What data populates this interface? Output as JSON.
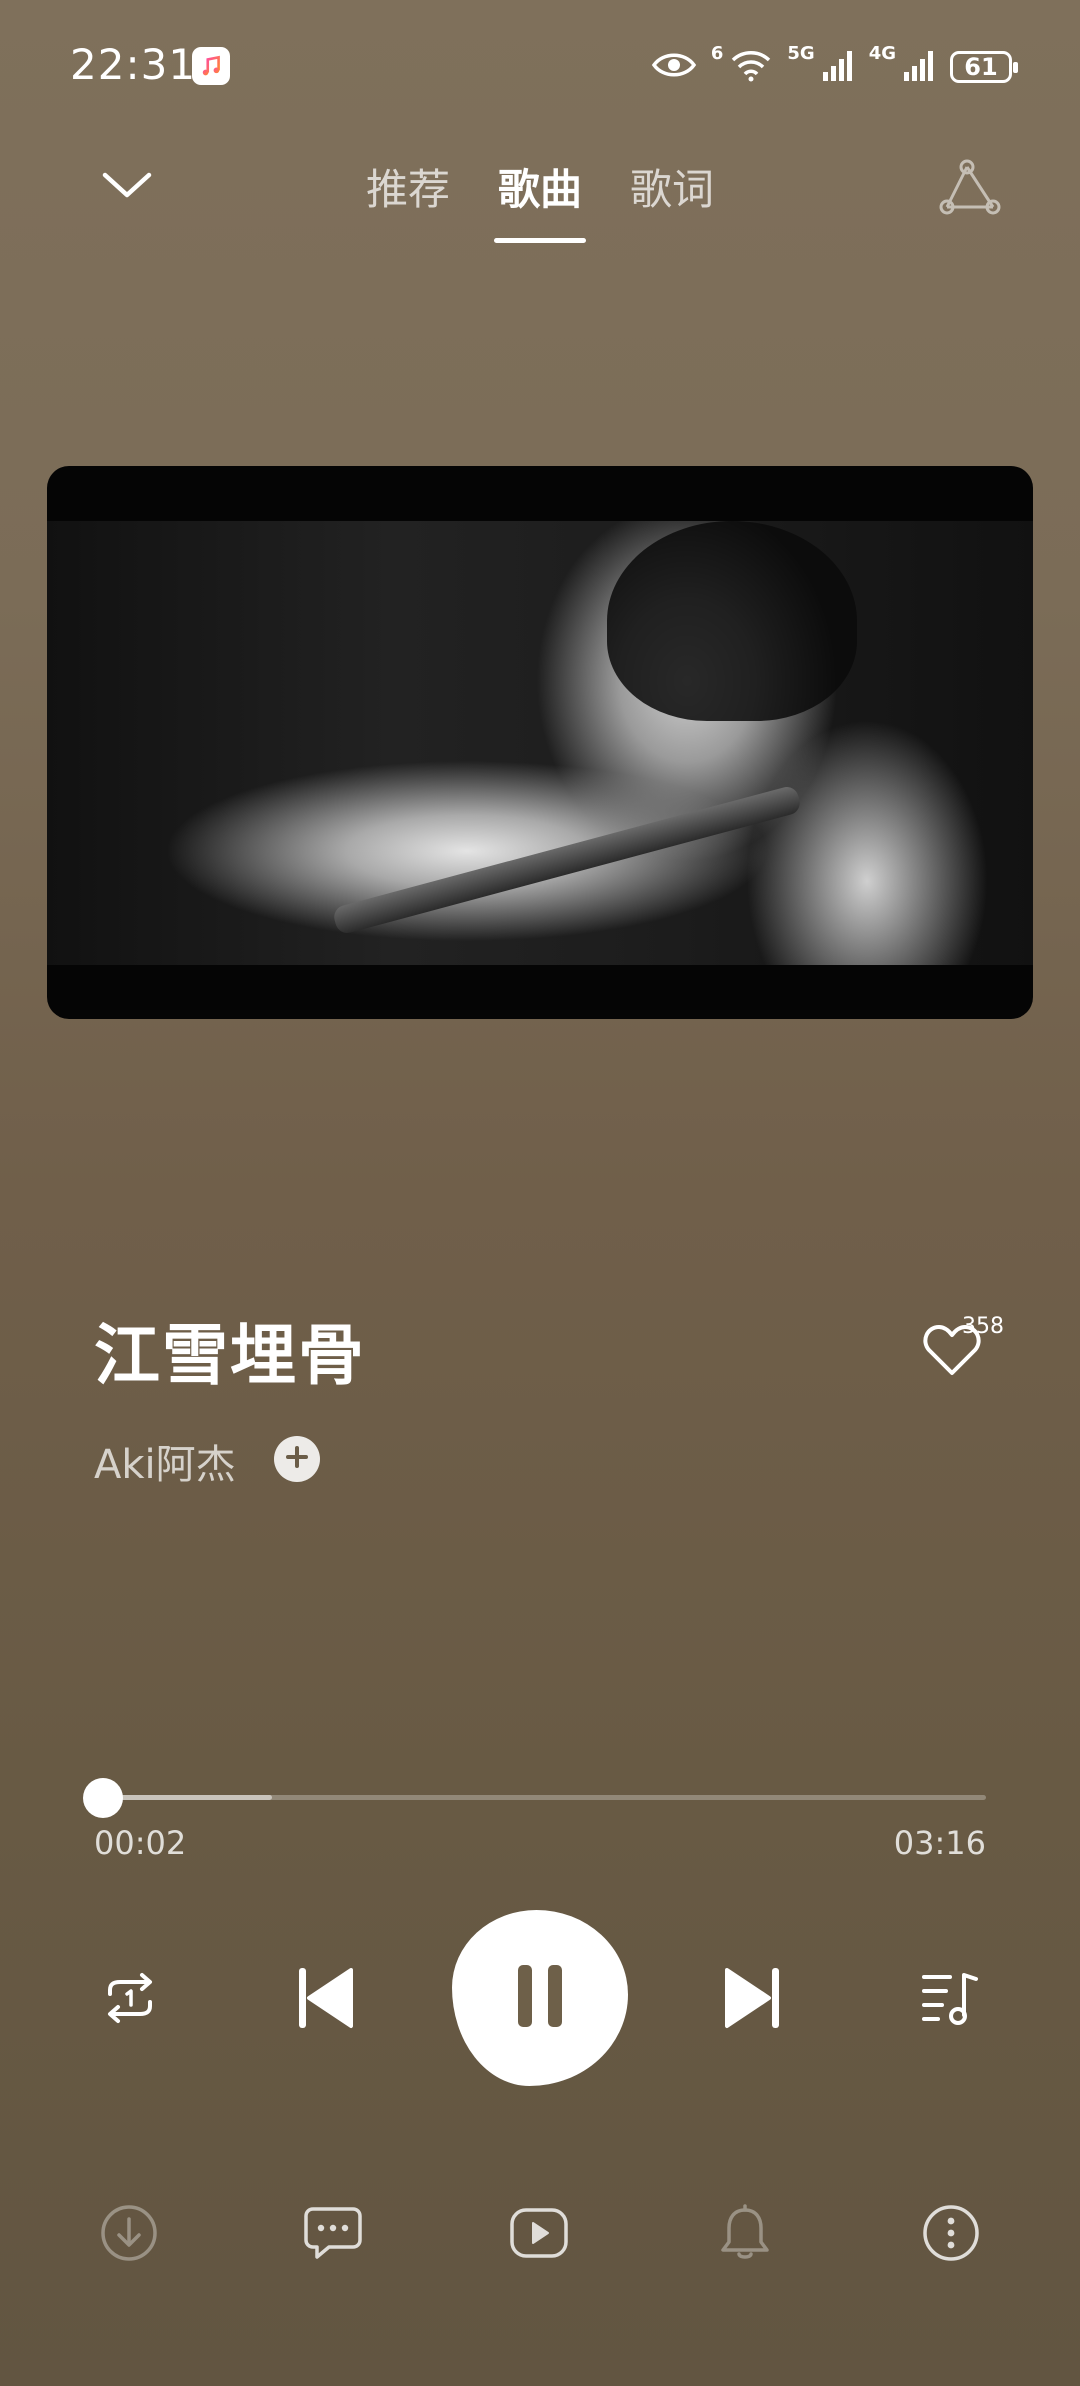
{
  "status_bar": {
    "time": "22:31",
    "app_icon": "music-note-icon",
    "icons": [
      "eye-icon",
      "wifi-icon",
      "signal-5g-icon",
      "signal-4g-icon"
    ],
    "wifi_label": "6",
    "net_5g_label": "5G",
    "net_4g_label": "4G",
    "battery": "61"
  },
  "header": {
    "collapse_icon": "chevron-down-icon",
    "tabs": [
      {
        "label": "推荐",
        "active": false
      },
      {
        "label": "歌曲",
        "active": true
      },
      {
        "label": "歌词",
        "active": false
      }
    ],
    "share_icon": "share-icon"
  },
  "song": {
    "title": "江雪埋骨",
    "artist": "Aki阿杰",
    "like_count": "358",
    "like_icon": "heart-icon",
    "follow_icon": "plus-icon"
  },
  "player": {
    "elapsed": "00:02",
    "total": "03:16",
    "progress_fraction": 0.01,
    "buffered_fraction": 0.2,
    "state": "playing",
    "controls": [
      "repeat-icon",
      "previous-icon",
      "pause-icon",
      "next-icon",
      "playlist-icon"
    ]
  },
  "toolbar": {
    "items": [
      "download-icon",
      "comment-icon",
      "video-icon",
      "bell-icon",
      "more-icon"
    ]
  },
  "colors": {
    "background_top": "#7f705b",
    "background_bottom": "#625541",
    "accent": "#ffffff"
  }
}
